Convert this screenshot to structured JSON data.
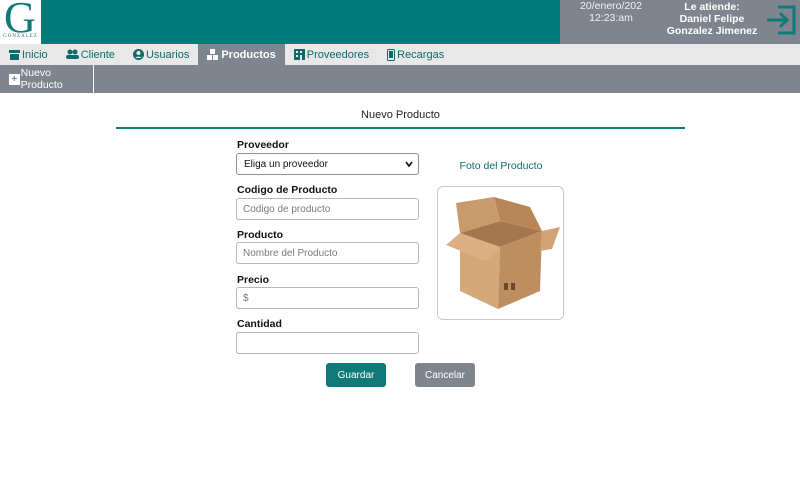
{
  "header": {
    "logo_letter": "G",
    "logo_text": "GONZALEZ",
    "date": "20/enero/202",
    "time": "12:23:am",
    "attend_label": "Le atiende:",
    "attend_name": "Daniel Felipe Gonzalez Jimenez",
    "exit_icon": "logout-icon"
  },
  "nav": {
    "tabs": [
      {
        "label": "Inicio",
        "icon": "store-icon"
      },
      {
        "label": "Cliente",
        "icon": "users-icon"
      },
      {
        "label": "Usuarios",
        "icon": "user-circle-icon"
      },
      {
        "label": "Productos",
        "icon": "boxes-icon",
        "active": true
      },
      {
        "label": "Proveedores",
        "icon": "building-icon"
      },
      {
        "label": "Recargas",
        "icon": "mobile-icon"
      }
    ]
  },
  "subbar": {
    "new_product_label": "Nuevo Producto"
  },
  "form": {
    "title": "Nuevo Producto",
    "proveedor_label": "Proveedor",
    "proveedor_selected": "Eliga un proveedor",
    "codigo_label": "Codigo de Producto",
    "codigo_placeholder": "Codigo de producto",
    "producto_label": "Producto",
    "producto_placeholder": "Nombre del Producto",
    "precio_label": "Precio",
    "precio_placeholder": "$",
    "cantidad_label": "Cantidad",
    "cantidad_placeholder": "",
    "photo_label": "Foto del Producto",
    "save_label": "Guardar",
    "cancel_label": "Cancelar"
  },
  "colors": {
    "teal": "#007b7a",
    "gray": "#7f858e"
  }
}
